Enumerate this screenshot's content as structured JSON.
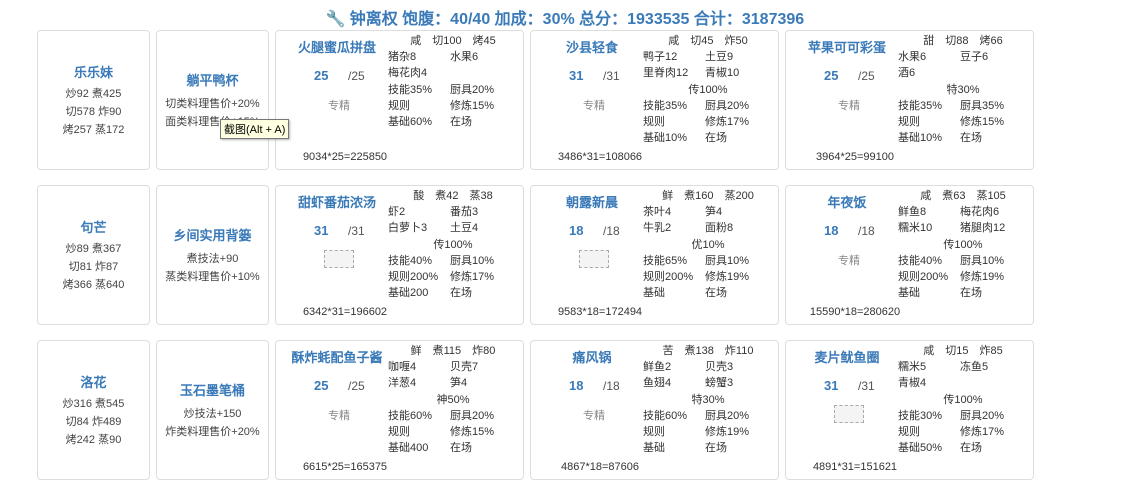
{
  "header": {
    "icon": "wrench-icon",
    "text": "钟离权 饱腹：40/40 加成：30% 总分：1933535 合计：3187396"
  },
  "tooltip": "截图(Alt + A)",
  "rows": [
    {
      "chef": {
        "name": "乐乐妹",
        "stats": [
          "炒92 煮425",
          "切578 炸90",
          "烤257 蒸172"
        ]
      },
      "equip": {
        "name": "躺平鸭杯",
        "effects": [
          "切类料理售价+20%",
          "面类料理售价+15%"
        ]
      },
      "recipes": [
        {
          "name": "火腿蜜瓜拼盘",
          "qty": "25",
          "max": "/25",
          "skill": "专精",
          "calc": "9034*25=225850",
          "cond": "咸　切100　烤45",
          "ings": [
            [
              "猪杂8",
              "水果6"
            ],
            [
              "梅花肉4",
              ""
            ]
          ],
          "bonus": "",
          "mods": [
            [
              "技能35%",
              "厨具20%"
            ],
            [
              "规则",
              "修炼15%"
            ],
            [
              "基础60%",
              "在场"
            ]
          ]
        },
        {
          "name": "沙县轻食",
          "qty": "31",
          "max": "/31",
          "skill": "专精",
          "calc": "3486*31=108066",
          "cond": "咸　切45　炸50",
          "ings": [
            [
              "鸭子12",
              "土豆9"
            ],
            [
              "里脊肉12",
              "青椒10"
            ]
          ],
          "bonus": "传100%",
          "mods": [
            [
              "技能35%",
              "厨具20%"
            ],
            [
              "规则",
              "修炼17%"
            ],
            [
              "基础10%",
              "在场"
            ]
          ]
        },
        {
          "name": "苹果可可彩蛋",
          "qty": "25",
          "max": "/25",
          "skill": "专精",
          "calc": "3964*25=99100",
          "cond": "甜　切88　烤66",
          "ings": [
            [
              "水果6",
              "豆子6"
            ],
            [
              "酒6",
              ""
            ]
          ],
          "bonus": "特30%",
          "mods": [
            [
              "技能35%",
              "厨具35%"
            ],
            [
              "规则",
              "修炼15%"
            ],
            [
              "基础10%",
              "在场"
            ]
          ]
        }
      ]
    },
    {
      "chef": {
        "name": "句芒",
        "stats": [
          "炒89 煮367",
          "切81 炸87",
          "烤366 蒸640"
        ]
      },
      "equip": {
        "name": "乡间实用背篓",
        "effects": [
          "煮技法+90",
          "蒸类料理售价+10%"
        ]
      },
      "recipes": [
        {
          "name": "甜虾番茄浓汤",
          "qty": "31",
          "max": "/31",
          "skill": "img",
          "calc": "6342*31=196602",
          "cond": "酸　煮42　蒸38",
          "ings": [
            [
              "虾2",
              "番茄3"
            ],
            [
              "白萝卜3",
              "土豆4"
            ]
          ],
          "bonus": "传100%",
          "mods": [
            [
              "技能40%",
              "厨具10%"
            ],
            [
              "规则200%",
              "修炼17%"
            ],
            [
              "基础200",
              "在场"
            ]
          ]
        },
        {
          "name": "朝露新晨",
          "qty": "18",
          "max": "/18",
          "skill": "img",
          "calc": "9583*18=172494",
          "cond": "鲜　煮160　蒸200",
          "ings": [
            [
              "茶叶4",
              "笋4"
            ],
            [
              "牛乳2",
              "面粉8"
            ]
          ],
          "bonus": "优10%",
          "mods": [
            [
              "技能65%",
              "厨具10%"
            ],
            [
              "规则200%",
              "修炼19%"
            ],
            [
              "基础",
              "在场"
            ]
          ]
        },
        {
          "name": "年夜饭",
          "qty": "18",
          "max": "/18",
          "skill": "专精",
          "calc": "15590*18=280620",
          "cond": "咸　煮63　蒸105",
          "ings": [
            [
              "鲜鱼8",
              "梅花肉6"
            ],
            [
              "糯米10",
              "猪腿肉12"
            ]
          ],
          "bonus": "传100%",
          "mods": [
            [
              "技能40%",
              "厨具10%"
            ],
            [
              "规则200%",
              "修炼19%"
            ],
            [
              "基础",
              "在场"
            ]
          ]
        }
      ]
    },
    {
      "chef": {
        "name": "洛花",
        "stats": [
          "炒316 煮545",
          "切84 炸489",
          "烤242 蒸90"
        ]
      },
      "equip": {
        "name": "玉石墨笔桶",
        "effects": [
          "炒技法+150",
          "炸类料理售价+20%"
        ]
      },
      "recipes": [
        {
          "name": "酥炸蚝配鱼子酱",
          "qty": "25",
          "max": "/25",
          "skill": "专精",
          "calc": "6615*25=165375",
          "cond": "鲜　煮115　炸80",
          "ings": [
            [
              "咖喱4",
              "贝壳7"
            ],
            [
              "洋葱4",
              "笋4"
            ]
          ],
          "bonus": "神50%",
          "mods": [
            [
              "技能60%",
              "厨具20%"
            ],
            [
              "规则",
              "修炼15%"
            ],
            [
              "基础400",
              "在场"
            ]
          ]
        },
        {
          "name": "痛风锅",
          "qty": "18",
          "max": "/18",
          "skill": "专精",
          "calc": "4867*18=87606",
          "cond": "苦　煮138　炸110",
          "ings": [
            [
              "鲜鱼2",
              "贝壳3"
            ],
            [
              "鱼翅4",
              "螃蟹3"
            ]
          ],
          "bonus": "特30%",
          "mods": [
            [
              "技能60%",
              "厨具20%"
            ],
            [
              "规则",
              "修炼19%"
            ],
            [
              "基础",
              "在场"
            ]
          ]
        },
        {
          "name": "麦片鱿鱼圈",
          "qty": "31",
          "max": "/31",
          "skill": "img",
          "calc": "4891*31=151621",
          "cond": "咸　切15　炸85",
          "ings": [
            [
              "糯米5",
              "冻鱼5"
            ],
            [
              "青椒4",
              ""
            ]
          ],
          "bonus": "传100%",
          "mods": [
            [
              "技能30%",
              "厨具20%"
            ],
            [
              "规则",
              "修炼17%"
            ],
            [
              "基础50%",
              "在场"
            ]
          ]
        }
      ]
    }
  ]
}
